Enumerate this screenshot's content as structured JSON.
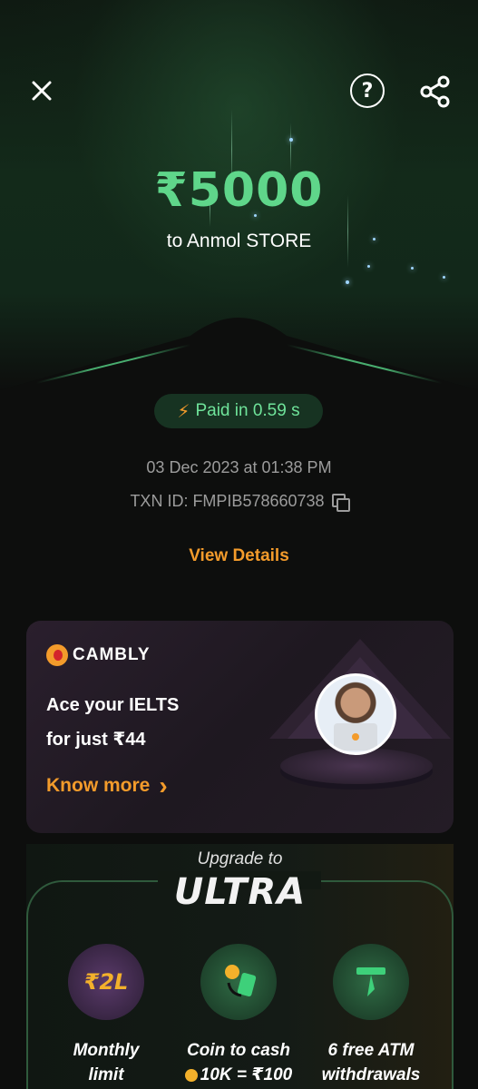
{
  "header": {
    "close_icon": "close-icon",
    "help_icon": "help-icon",
    "help_glyph": "?",
    "share_icon": "share-icon"
  },
  "payment": {
    "amount": "₹5000",
    "payee": "to Anmol STORE",
    "speed_badge": "Paid in 0.59 s",
    "datetime": "03 Dec 2023 at 01:38 PM",
    "txn_id": "TXN ID: FMPIB578660738",
    "view_details": "View Details"
  },
  "promo": {
    "brand": "CAMBLY",
    "line1": "Ace your IELTS",
    "line2": "for just ₹44",
    "cta": "Know more",
    "cta_chevron": "›"
  },
  "ultra": {
    "upgrade_to": "Upgrade to",
    "title": "ULTRA",
    "features": [
      {
        "label_line1": "Monthly",
        "label_line2": "limit",
        "icon": "limit-2L-icon",
        "icon_text": "₹2L"
      },
      {
        "label_line1": "Coin to cash",
        "label_line2": "10K = ₹100",
        "icon": "coin-to-cash-icon"
      },
      {
        "label_line1": "6 free ATM",
        "label_line2": "withdrawals",
        "icon": "atm-withdrawal-icon"
      }
    ]
  },
  "colors": {
    "accent_green": "#5fd68a",
    "accent_orange": "#f39b2b",
    "background": "#0d0e0d"
  }
}
